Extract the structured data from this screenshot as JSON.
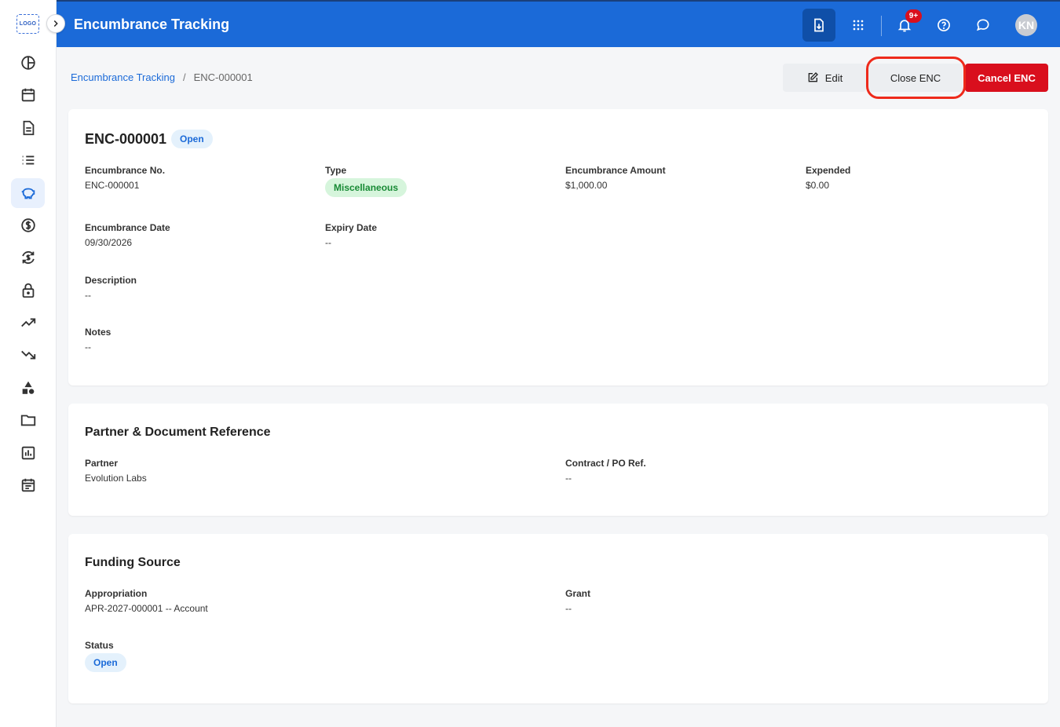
{
  "sidebar": {
    "logo": "LOGO",
    "items": [
      {
        "icon": "pie-chart-icon"
      },
      {
        "icon": "calendar-icon"
      },
      {
        "icon": "document-icon"
      },
      {
        "icon": "list-icon"
      },
      {
        "icon": "piggy-bank-icon",
        "active": true
      },
      {
        "icon": "dollar-circle-icon"
      },
      {
        "icon": "currency-refresh-icon"
      },
      {
        "icon": "lock-icon"
      },
      {
        "icon": "trending-up-icon"
      },
      {
        "icon": "trending-down-icon"
      },
      {
        "icon": "shapes-icon"
      },
      {
        "icon": "folder-icon"
      },
      {
        "icon": "bar-report-icon"
      },
      {
        "icon": "calendar-list-icon"
      }
    ]
  },
  "header": {
    "title": "Encumbrance Tracking",
    "notification_count": "9+",
    "avatar_initials": "KN"
  },
  "breadcrumb": {
    "parent": "Encumbrance Tracking",
    "separator": "/",
    "current": "ENC-000001"
  },
  "actions": {
    "edit": "Edit",
    "close": "Close ENC",
    "cancel": "Cancel ENC"
  },
  "details": {
    "title": "ENC-000001",
    "status_badge": "Open",
    "encumbrance_no": {
      "label": "Encumbrance No.",
      "value": "ENC-000001"
    },
    "type": {
      "label": "Type",
      "value": "Miscellaneous"
    },
    "amount": {
      "label": "Encumbrance Amount",
      "value": "$1,000.00"
    },
    "expended": {
      "label": "Expended",
      "value": "$0.00"
    },
    "date": {
      "label": "Encumbrance Date",
      "value": "09/30/2026"
    },
    "expiry": {
      "label": "Expiry Date",
      "value": "--"
    },
    "description": {
      "label": "Description",
      "value": "--"
    },
    "notes": {
      "label": "Notes",
      "value": "--"
    }
  },
  "partner_section": {
    "title": "Partner & Document Reference",
    "partner": {
      "label": "Partner",
      "value": "Evolution Labs"
    },
    "contract": {
      "label": "Contract / PO Ref.",
      "value": "--"
    }
  },
  "funding_section": {
    "title": "Funding Source",
    "appropriation": {
      "label": "Appropriation",
      "value": "APR-2027-000001 -- Account"
    },
    "grant": {
      "label": "Grant",
      "value": "--"
    },
    "status": {
      "label": "Status",
      "value": "Open"
    }
  },
  "colors": {
    "primary": "#1b6ad8",
    "danger": "#d90f1d",
    "highlight": "#ee2a1b"
  }
}
